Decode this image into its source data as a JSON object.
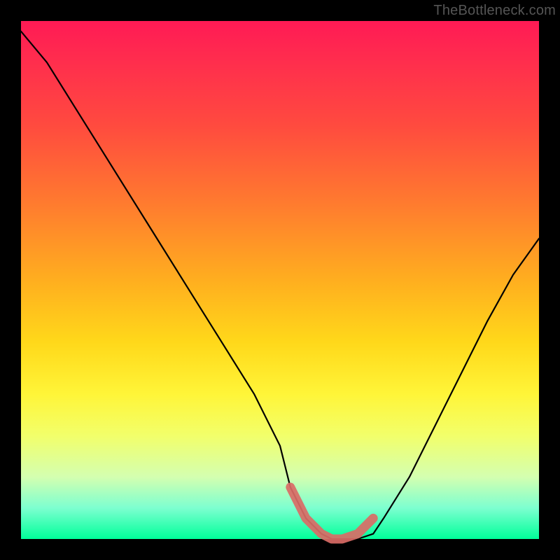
{
  "watermark": "TheBottleneck.com",
  "chart_data": {
    "type": "line",
    "title": "",
    "xlabel": "",
    "ylabel": "",
    "xlim": [
      0,
      100
    ],
    "ylim": [
      0,
      100
    ],
    "grid": false,
    "legend": false,
    "x": [
      0,
      5,
      10,
      15,
      20,
      25,
      30,
      35,
      40,
      45,
      50,
      52,
      55,
      58,
      60,
      62,
      65,
      68,
      70,
      75,
      80,
      85,
      90,
      95,
      100
    ],
    "series": [
      {
        "name": "bottleneck-curve",
        "values": [
          98,
          92,
          84,
          76,
          68,
          60,
          52,
          44,
          36,
          28,
          18,
          10,
          4,
          1,
          0,
          0,
          0,
          1,
          4,
          12,
          22,
          32,
          42,
          51,
          58
        ]
      }
    ],
    "highlight_segment": {
      "x": [
        52,
        55,
        58,
        60,
        62,
        65,
        68
      ],
      "values": [
        10,
        4,
        1,
        0,
        0,
        1,
        4
      ]
    }
  }
}
